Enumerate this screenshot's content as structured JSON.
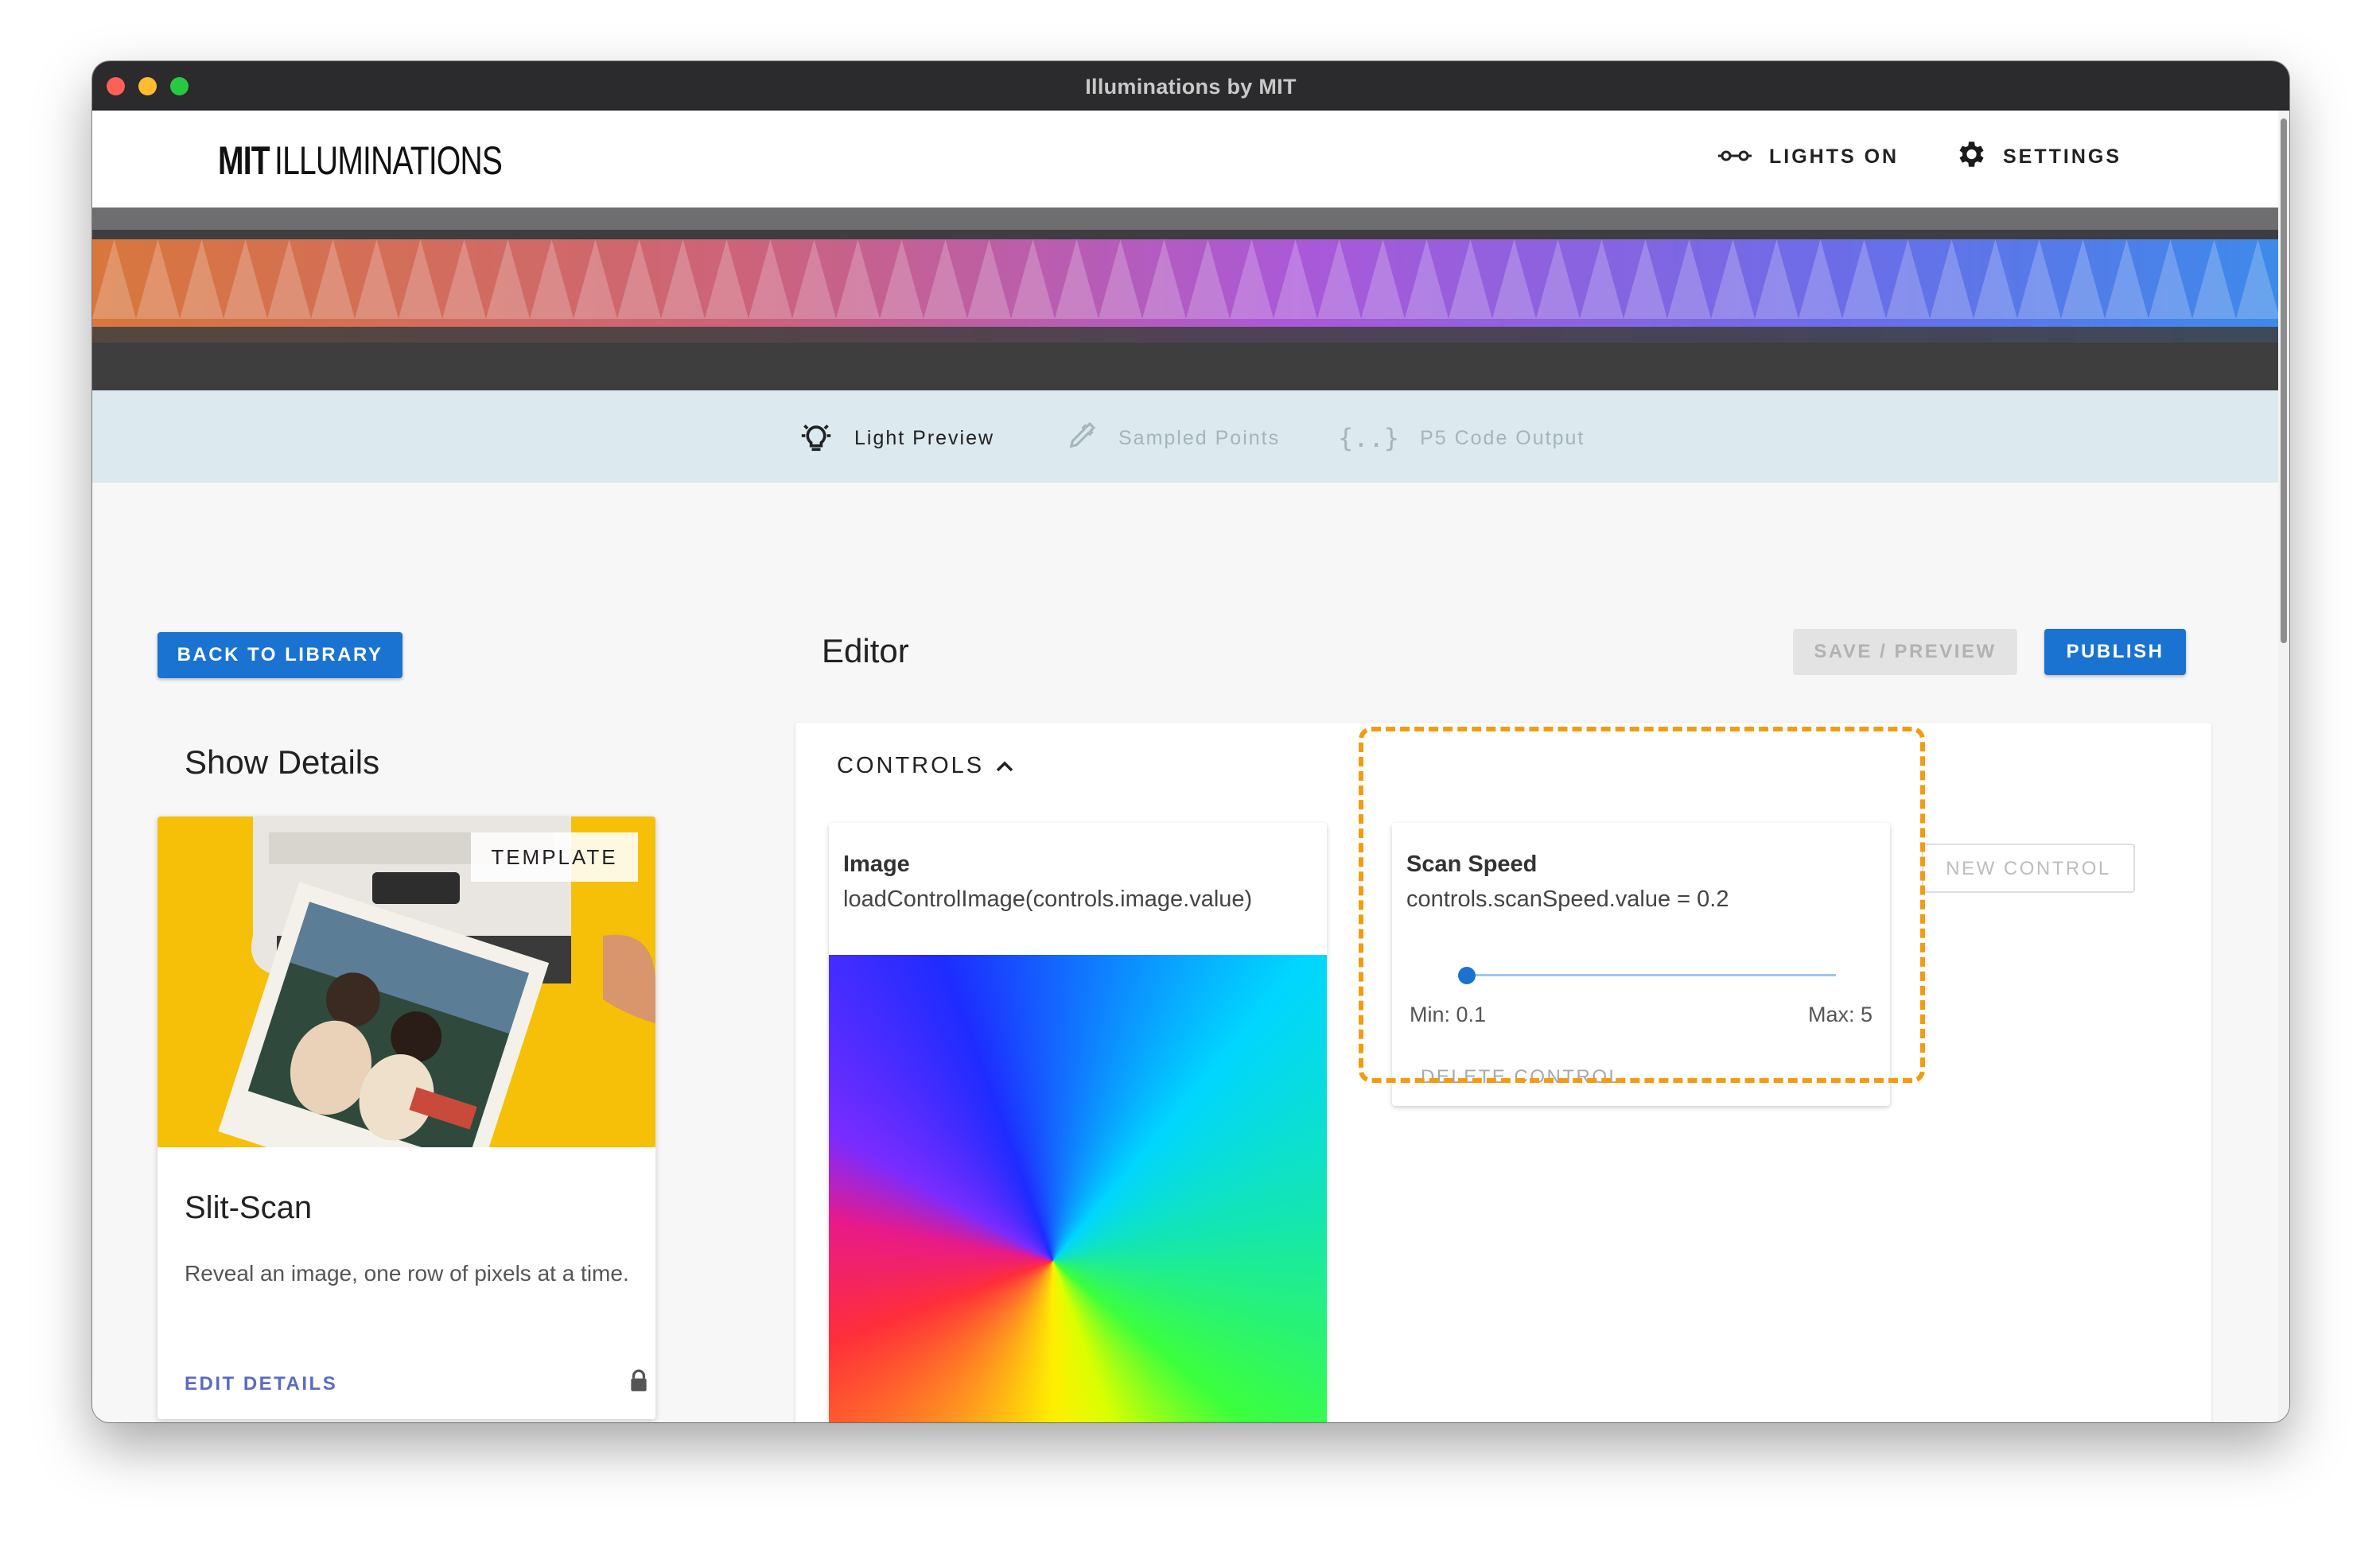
{
  "window": {
    "title": "Illuminations by MIT"
  },
  "header": {
    "logo_bold": "MIT",
    "logo_rest": "ILLUMINATIONS",
    "lights_label": "LIGHTS ON",
    "settings_label": "SETTINGS"
  },
  "tabs": [
    {
      "label": "Light Preview",
      "icon": "lightbulb-icon",
      "active": true
    },
    {
      "label": "Sampled Points",
      "icon": "eyedropper-icon",
      "active": false
    },
    {
      "label": "P5 Code Output",
      "icon": "code-braces-icon",
      "active": false
    }
  ],
  "toolbar": {
    "back_label": "BACK TO LIBRARY",
    "editor_title": "Editor",
    "save_label": "SAVE / PREVIEW",
    "publish_label": "PUBLISH"
  },
  "show_details": {
    "heading": "Show Details",
    "template_chip": "TEMPLATE",
    "title": "Slit-Scan",
    "description": "Reveal an image, one row of pixels at a time.",
    "edit_label": "EDIT DETAILS"
  },
  "controls": {
    "label": "CONTROLS",
    "new_control_label": "NEW CONTROL",
    "image": {
      "name": "Image",
      "code": "loadControlImage(controls.image.value)"
    },
    "scan_speed": {
      "name": "Scan Speed",
      "code": "controls.scanSpeed.value = 0.2",
      "value": 0.2,
      "min": 0.1,
      "max": 5,
      "min_label": "Min: 0.1",
      "max_label": "Max: 5",
      "delete_label": "DELETE CONTROL"
    }
  },
  "colors": {
    "accent": "#1a73d1",
    "highlight": "#f29c12",
    "tab_bar": "#dce9ee",
    "card_image_bg": "#f5c007"
  }
}
